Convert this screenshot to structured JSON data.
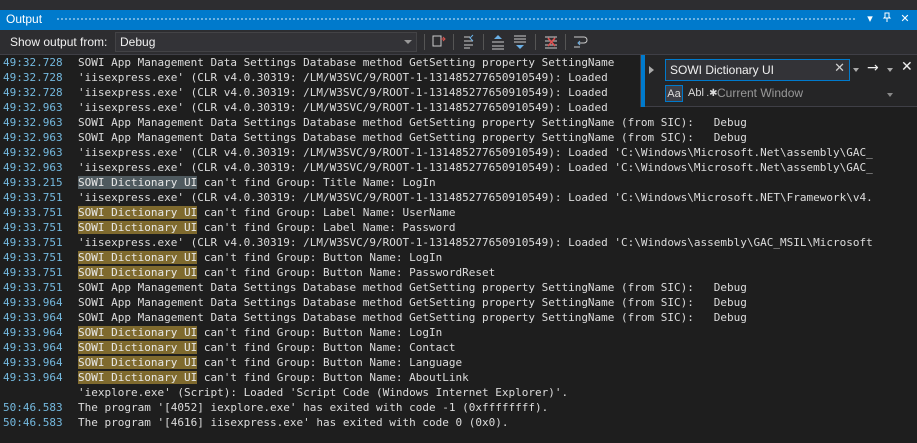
{
  "window": {
    "title": "Output"
  },
  "toolbar": {
    "show_output_label": "Show output from:",
    "source": "Debug"
  },
  "find": {
    "query": "SOWI Dictionary UI",
    "match_case": "Aa",
    "whole_word": "Abl",
    "scope": "Current Window"
  },
  "lines": [
    {
      "t": "49:32.728",
      "p": "",
      "h": "",
      "s": "SOWI App Management Data Settings Database method GetSetting property SettingName"
    },
    {
      "t": "49:32.728",
      "p": "",
      "h": "",
      "s": "'iisexpress.exe' (CLR v4.0.30319: /LM/W3SVC/9/ROOT-1-131485277650910549): Loaded"
    },
    {
      "t": "49:32.728",
      "p": "",
      "h": "",
      "s": "'iisexpress.exe' (CLR v4.0.30319: /LM/W3SVC/9/ROOT-1-131485277650910549): Loaded"
    },
    {
      "t": "49:32.963",
      "p": "",
      "h": "",
      "s": "'iisexpress.exe' (CLR v4.0.30319: /LM/W3SVC/9/ROOT-1-131485277650910549): Loaded"
    },
    {
      "t": "49:32.963",
      "p": "",
      "h": "",
      "s": "SOWI App Management Data Settings Database method GetSetting property SettingName (from SIC):   Debug"
    },
    {
      "t": "49:32.963",
      "p": "",
      "h": "",
      "s": "SOWI App Management Data Settings Database method GetSetting property SettingName (from SIC):   Debug"
    },
    {
      "t": "49:32.963",
      "p": "",
      "h": "",
      "s": "'iisexpress.exe' (CLR v4.0.30319: /LM/W3SVC/9/ROOT-1-131485277650910549): Loaded 'C:\\Windows\\Microsoft.Net\\assembly\\GAC_"
    },
    {
      "t": "49:32.963",
      "p": "",
      "h": "",
      "s": "'iisexpress.exe' (CLR v4.0.30319: /LM/W3SVC/9/ROOT-1-131485277650910549): Loaded 'C:\\Windows\\Microsoft.Net\\assembly\\GAC_"
    },
    {
      "t": "49:33.215",
      "p": "",
      "h": "SOWI Dictionary UI",
      "sel": true,
      "s": " can't find Group: Title Name: LogIn"
    },
    {
      "t": "49:33.751",
      "p": "",
      "h": "",
      "s": "'iisexpress.exe' (CLR v4.0.30319: /LM/W3SVC/9/ROOT-1-131485277650910549): Loaded 'C:\\Windows\\Microsoft.NET\\Framework\\v4."
    },
    {
      "t": "49:33.751",
      "p": "",
      "h": "SOWI Dictionary UI",
      "s": " can't find Group: Label Name: UserName"
    },
    {
      "t": "49:33.751",
      "p": "",
      "h": "SOWI Dictionary UI",
      "s": " can't find Group: Label Name: Password"
    },
    {
      "t": "49:33.751",
      "p": "",
      "h": "",
      "s": "'iisexpress.exe' (CLR v4.0.30319: /LM/W3SVC/9/ROOT-1-131485277650910549): Loaded 'C:\\Windows\\assembly\\GAC_MSIL\\Microsoft"
    },
    {
      "t": "49:33.751",
      "p": "",
      "h": "SOWI Dictionary UI",
      "s": " can't find Group: Button Name: LogIn"
    },
    {
      "t": "49:33.751",
      "p": "",
      "h": "SOWI Dictionary UI",
      "s": " can't find Group: Button Name: PasswordReset"
    },
    {
      "t": "49:33.751",
      "p": "",
      "h": "",
      "s": "SOWI App Management Data Settings Database method GetSetting property SettingName (from SIC):   Debug"
    },
    {
      "t": "49:33.964",
      "p": "",
      "h": "",
      "s": "SOWI App Management Data Settings Database method GetSetting property SettingName (from SIC):   Debug"
    },
    {
      "t": "49:33.964",
      "p": "",
      "h": "",
      "s": "SOWI App Management Data Settings Database method GetSetting property SettingName (from SIC):   Debug"
    },
    {
      "t": "49:33.964",
      "p": "",
      "h": "SOWI Dictionary UI",
      "s": " can't find Group: Button Name: LogIn"
    },
    {
      "t": "49:33.964",
      "p": "",
      "h": "SOWI Dictionary UI",
      "s": " can't find Group: Button Name: Contact"
    },
    {
      "t": "49:33.964",
      "p": "",
      "h": "SOWI Dictionary UI",
      "s": " can't find Group: Button Name: Language"
    },
    {
      "t": "49:33.964",
      "p": "",
      "h": "SOWI Dictionary UI",
      "s": " can't find Group: Button Name: AboutLink"
    },
    {
      "t": "",
      "p": "",
      "h": "",
      "s": "'iexplore.exe' (Script): Loaded 'Script Code (Windows Internet Explorer)'."
    },
    {
      "t": "50:46.583",
      "p": "",
      "h": "",
      "s": "The program '[4052] iexplore.exe' has exited with code -1 (0xffffffff)."
    },
    {
      "t": "50:46.583",
      "p": "",
      "h": "",
      "s": "The program '[4616] iisexpress.exe' has exited with code 0 (0x0)."
    }
  ]
}
